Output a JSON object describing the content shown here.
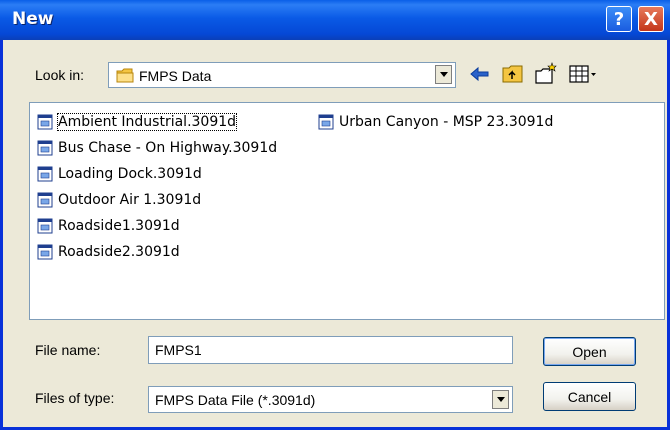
{
  "window": {
    "title": "New",
    "help_label": "?",
    "close_label": "X"
  },
  "lookin": {
    "label": "Look in:",
    "folder_value": "FMPS Data"
  },
  "toolbar": {
    "icons": [
      "back-arrow-icon",
      "up-folder-icon",
      "new-folder-icon",
      "view-menu-icon"
    ]
  },
  "files": [
    "Ambient Industrial.3091d",
    "Bus Chase - On Highway.3091d",
    "Loading Dock.3091d",
    "Outdoor Air 1.3091d",
    "Roadside1.3091d",
    "Roadside2.3091d",
    "Urban Canyon - MSP 23.3091d"
  ],
  "filename": {
    "label": "File name:",
    "value": "FMPS1"
  },
  "filetype": {
    "label": "Files of type:",
    "value": "FMPS Data File (*.3091d)"
  },
  "buttons": {
    "open": "Open",
    "cancel": "Cancel"
  }
}
